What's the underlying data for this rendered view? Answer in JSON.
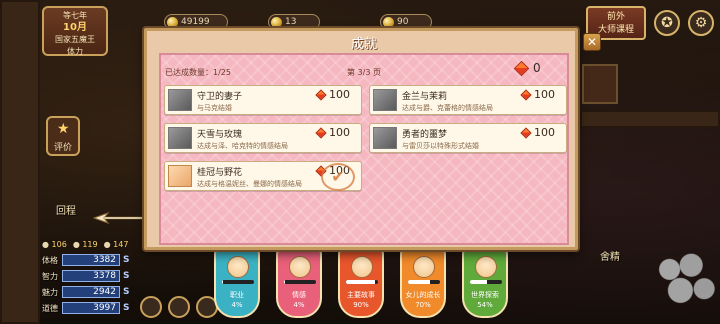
{
  "modal": {
    "title": "成就",
    "close_icon": "close-icon",
    "achieved_label": "已达成数量：1/25",
    "page_label": "第 3/3 页",
    "total_points": "0",
    "achievements": [
      {
        "name": "守卫的妻子",
        "desc": "与马克结婚",
        "points": "100",
        "achieved": false
      },
      {
        "name": "金兰与茉莉",
        "desc": "达成与爵、克蕾格的情感结局",
        "points": "100",
        "achieved": false
      },
      {
        "name": "天雪与玫瑰",
        "desc": "达成与泽、哈克特的情感结局",
        "points": "100",
        "achieved": false
      },
      {
        "name": "勇者的噩梦",
        "desc": "与雷贝莎以特殊形式结婚",
        "points": "100",
        "achieved": false
      },
      {
        "name": "桂冠与野花",
        "desc": "达成与格温妮丝、曼娜的情感结局",
        "points": "100",
        "achieved": true
      }
    ]
  },
  "hud": {
    "calendar": {
      "line1": "等七年",
      "line2": "10月",
      "line3": "国家五魔王",
      "line4": "体力"
    },
    "gold": "49199",
    "res2": "13",
    "res3": "90",
    "sign": {
      "line1": "前外",
      "line2": "大师课程"
    },
    "eval_label": "评价",
    "back_label": "回程",
    "right_label": "舍精",
    "gauges": {
      "a": "106",
      "b": "119",
      "c": "147"
    },
    "stats": [
      {
        "label": "体格",
        "value": "3382",
        "grade": "S"
      },
      {
        "label": "智力",
        "value": "3378",
        "grade": "S"
      },
      {
        "label": "魅力",
        "value": "2942",
        "grade": "S"
      },
      {
        "label": "道德",
        "value": "3997",
        "grade": "S"
      }
    ],
    "categories": [
      {
        "name": "职业",
        "pct": "4%",
        "fill": 0.04,
        "color": "#3bb2c4"
      },
      {
        "name": "情感",
        "pct": "4%",
        "fill": 0.04,
        "color": "#e9607a"
      },
      {
        "name": "主要故事",
        "pct": "90%",
        "fill": 0.9,
        "color": "#e8562c"
      },
      {
        "name": "女儿的成长",
        "pct": "70%",
        "fill": 0.7,
        "color": "#f08a2a"
      },
      {
        "name": "世界探索",
        "pct": "54%",
        "fill": 0.54,
        "color": "#5faa3a"
      }
    ]
  }
}
